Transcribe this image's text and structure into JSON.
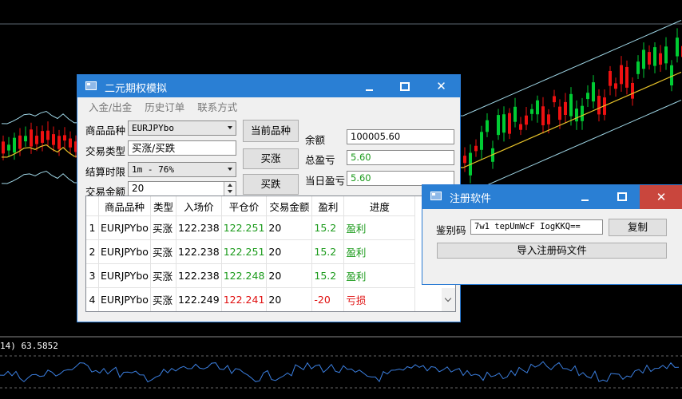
{
  "indicator_text": "14) 63.5852",
  "main_window": {
    "title": "二元期权模拟",
    "menu": [
      "入金/出金",
      "历史订单",
      "联系方式"
    ],
    "product_label": "商品品种",
    "product_value": "EURJPYbo",
    "trade_type_label": "交易类型",
    "trade_type_value": "买涨/买跌",
    "settle_label": "结算时限",
    "settle_value": "1m - 76%",
    "amount_label": "交易金额",
    "amount_value": "20",
    "current_product_button": "当前品种",
    "buy_up_button": "买涨",
    "buy_down_button": "买跌",
    "balance_label": "余额",
    "balance_value": "100005.60",
    "total_profit_label": "总盈亏",
    "total_profit_value": "5.60",
    "today_profit_label": "当日盈亏",
    "today_profit_value": "5.60",
    "table": {
      "headers": [
        "",
        "商品品种",
        "类型",
        "入场价",
        "平仓价",
        "交易金额",
        "盈利",
        "进度"
      ],
      "rows": [
        {
          "n": "1",
          "product": "EURJPYbo",
          "type": "买涨",
          "entry": "122.238",
          "close": "122.251",
          "amount": "20",
          "profit": "15.2",
          "status": "盈利",
          "result": "win"
        },
        {
          "n": "2",
          "product": "EURJPYbo",
          "type": "买涨",
          "entry": "122.238",
          "close": "122.251",
          "amount": "20",
          "profit": "15.2",
          "status": "盈利",
          "result": "win"
        },
        {
          "n": "3",
          "product": "EURJPYbo",
          "type": "买涨",
          "entry": "122.238",
          "close": "122.248",
          "amount": "20",
          "profit": "15.2",
          "status": "盈利",
          "result": "win"
        },
        {
          "n": "4",
          "product": "EURJPYbo",
          "type": "买涨",
          "entry": "122.249",
          "close": "122.241",
          "amount": "20",
          "profit": "-20",
          "status": "亏损",
          "result": "loss"
        }
      ]
    }
  },
  "register_window": {
    "title": "注册软件",
    "code_label": "鉴别码",
    "code_value": "7w1  tepUmWcF  IogKKQ==",
    "copy_button": "复制",
    "import_button": "导入注册码文件"
  },
  "colors": {
    "titlebar": "#2a7fd4",
    "profit_green": "#1a9a1a",
    "loss_red": "#e01010",
    "bull_candle": "#00cc33",
    "bear_candle": "#ee1111"
  }
}
